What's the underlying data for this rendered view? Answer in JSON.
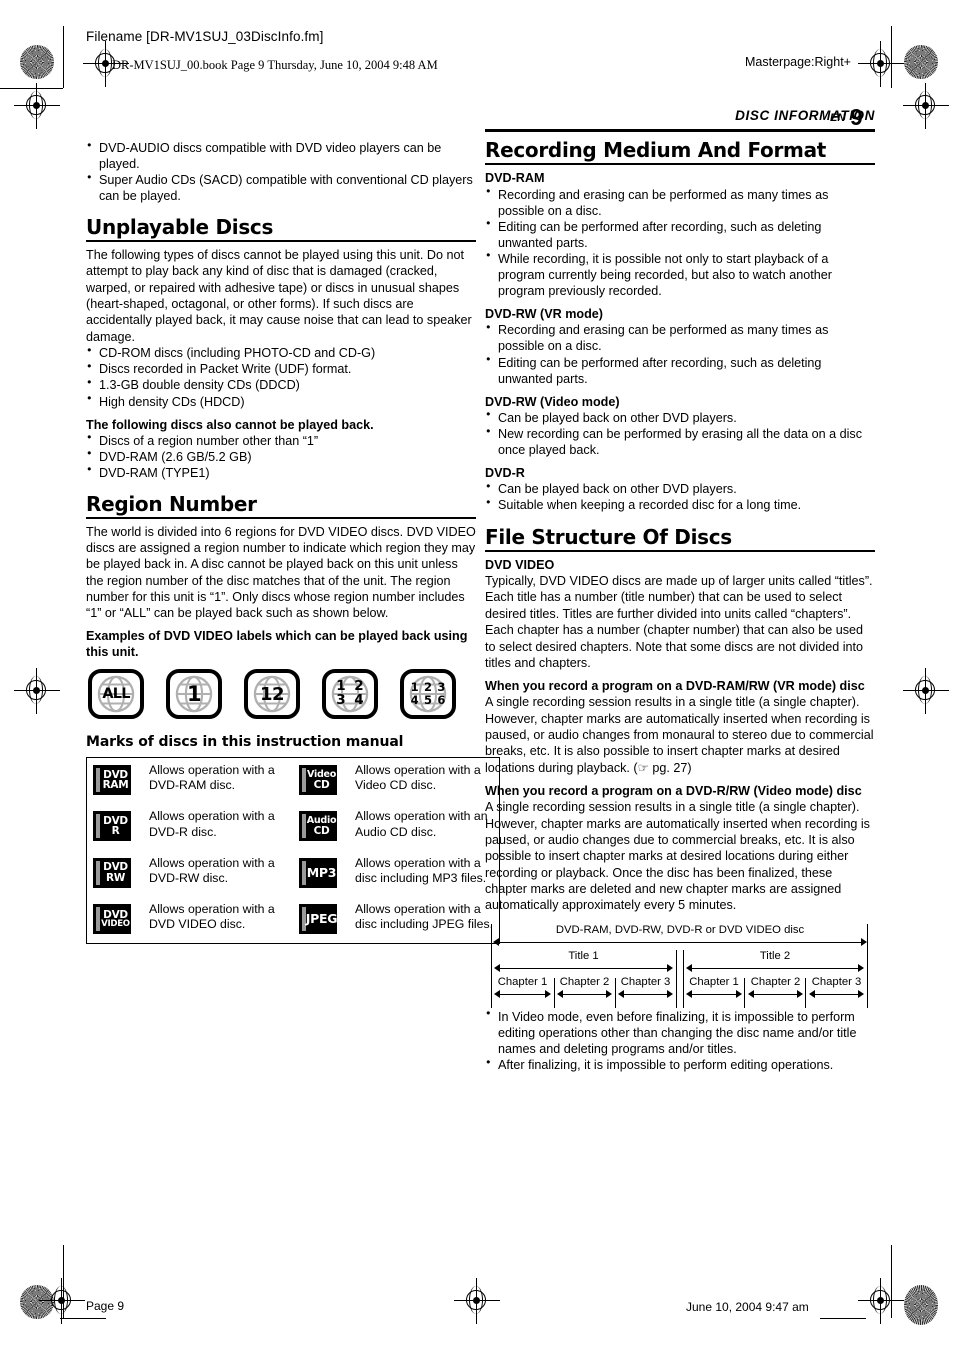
{
  "header": {
    "filename": "Filename [DR-MV1SUJ_03DiscInfo.fm]",
    "bookline": "DR-MV1SUJ_00.book  Page 9  Thursday, June 10, 2004  9:48 AM",
    "masterpage": "Masterpage:Right+",
    "running_head": "DISC INFORMATION",
    "lang_code": "EN",
    "page_number": "9"
  },
  "footer": {
    "page_label": "Page 9",
    "date": "June 10, 2004 9:47 am"
  },
  "left_column": {
    "intro_bullets": [
      "DVD-AUDIO discs compatible with DVD video players can be played.",
      "Super Audio CDs (SACD) compatible with conventional CD players can be played."
    ],
    "unplayable": {
      "title": "Unplayable Discs",
      "paragraph": "The following types of discs cannot be played using this unit. Do not attempt to play back any kind of disc that is damaged (cracked, warped, or repaired with adhesive tape) or discs in unusual shapes (heart-shaped, octagonal, or other forms). If such discs are accidentally played back, it may cause noise that can lead to speaker damage.",
      "bullets": [
        "CD-ROM discs (including PHOTO-CD and CD-G)",
        "Discs recorded in Packet Write (UDF) format.",
        "1.3-GB double density CDs (DDCD)",
        "High density CDs (HDCD)"
      ],
      "also_heading": "The following discs also cannot be played back.",
      "also_bullets": [
        "Discs of a region number other than “1”",
        "DVD-RAM (2.6 GB/5.2 GB)",
        "DVD-RAM (TYPE1)"
      ]
    },
    "region": {
      "title": "Region Number",
      "paragraph": "The world is divided into 6 regions for DVD VIDEO discs. DVD VIDEO discs are assigned a region number to indicate which region they may be played back in. A disc cannot be played back on this unit unless the region number of the disc matches that of the unit. The region number for this unit is “1”. Only discs whose region number includes “1” or “ALL” can be played back such as shown below.",
      "examples_heading": "Examples of DVD VIDEO labels which can be played back using this unit.",
      "icons": [
        {
          "name": "region-all",
          "type": "text",
          "text": "ALL"
        },
        {
          "name": "region-1",
          "type": "text",
          "text": "1"
        },
        {
          "name": "region-12",
          "type": "text",
          "text": "12"
        },
        {
          "name": "region-1234",
          "type": "grid2",
          "cells": [
            "1",
            "2",
            "3",
            "4"
          ]
        },
        {
          "name": "region-123456",
          "type": "grid3",
          "cells": [
            "1",
            "2",
            "3",
            "4",
            "5",
            "6"
          ]
        }
      ]
    },
    "marks": {
      "title": "Marks of discs in this instruction manual",
      "rows": [
        {
          "left": {
            "icon_lines": [
              "DVD",
              "RAM"
            ],
            "icon_size": "two-line",
            "text": "Allows operation with a DVD-RAM disc."
          },
          "right": {
            "icon_lines": [
              "Video",
              "CD"
            ],
            "icon_size": "two-line",
            "text": "Allows operation with a Video CD disc."
          }
        },
        {
          "left": {
            "icon_lines": [
              "DVD",
              "R"
            ],
            "icon_size": "two-line",
            "text": "Allows operation with a DVD-R disc."
          },
          "right": {
            "icon_lines": [
              "Audio",
              "CD"
            ],
            "icon_size": "two-line",
            "text": "Allows operation with an Audio CD disc."
          }
        },
        {
          "left": {
            "icon_lines": [
              "DVD",
              "RW"
            ],
            "icon_size": "two-line",
            "text": "Allows operation with a DVD-RW disc."
          },
          "right": {
            "icon_lines": [
              "MP3"
            ],
            "icon_size": "one-line",
            "text": "Allows operation with a disc including MP3 files."
          }
        },
        {
          "left": {
            "icon_lines": [
              "DVD",
              "VIDEO"
            ],
            "icon_size": "two-line-small",
            "text": "Allows operation with a DVD VIDEO disc."
          },
          "right": {
            "icon_lines": [
              "JPEG"
            ],
            "icon_size": "one-line",
            "text": "Allows operation with a disc including JPEG files."
          }
        }
      ]
    }
  },
  "right_column": {
    "recording": {
      "title": "Recording Medium And Format",
      "groups": [
        {
          "heading": "DVD-RAM",
          "bullets": [
            "Recording and erasing can be performed as many times as possible on a disc.",
            "Editing can be performed after recording, such as deleting unwanted parts.",
            "While recording, it is possible not only to start playback of a program currently being recorded, but also to watch another program previously recorded."
          ]
        },
        {
          "heading": "DVD-RW (VR mode)",
          "bullets": [
            "Recording and erasing can be performed as many times as possible on a disc.",
            "Editing can be performed after recording, such as deleting unwanted parts."
          ]
        },
        {
          "heading": "DVD-RW (Video mode)",
          "bullets": [
            "Can be played back on other DVD players.",
            "New recording can be performed by erasing all the data on a disc once played back."
          ]
        },
        {
          "heading": "DVD-R",
          "bullets": [
            "Can be played back on other DVD players.",
            "Suitable when keeping a recorded disc for a long time."
          ]
        }
      ]
    },
    "file_structure": {
      "title": "File Structure Of Discs",
      "dvd_video_heading": "DVD VIDEO",
      "dvd_video_paragraph": "Typically, DVD VIDEO discs are made up of larger units called “titles”. Each title has a number (title number) that can be used to select desired titles. Titles are further divided into units called “chapters”. Each chapter has a number (chapter number) that can also be used to select desired chapters. Note that some discs are not divided into titles and chapters.",
      "vr_heading": "When you record a program on a DVD-RAM/RW (VR mode) disc",
      "vr_paragraph": "A single recording session results in a single title (a single chapter). However, chapter marks are automatically inserted when recording is paused, or audio changes from monaural to stereo due to commercial breaks, etc. It is also possible to insert chapter marks at desired locations during playback. (",
      "vr_paragraph_ref": " pg. 27)",
      "video_heading": "When you record a program on a DVD-R/RW (Video mode) disc",
      "video_paragraph": "A single recording session results in a single title (a single chapter). However, chapter marks are automatically inserted when recording is paused, or audio changes due to commercial breaks, etc. It is also possible to insert chapter marks at desired locations during either recording or playback. Once the disc has been finalized, these chapter marks are deleted and new chapter marks are assigned automatically approximately every 5 minutes.",
      "diagram": {
        "disc_label": "DVD-RAM, DVD-RW, DVD-R or DVD VIDEO disc",
        "titles": [
          {
            "label": "Title 1",
            "chapters": [
              "Chapter 1",
              "Chapter 2",
              "Chapter 3"
            ]
          },
          {
            "label": "Title 2",
            "chapters": [
              "Chapter 1",
              "Chapter 2",
              "Chapter 3"
            ]
          }
        ]
      },
      "notes": [
        "In Video mode, even before finalizing, it is impossible to perform editing operations other than changing the disc name and/or title names and deleting programs and/or titles.",
        "After finalizing, it is impossible to perform editing operations."
      ]
    }
  }
}
